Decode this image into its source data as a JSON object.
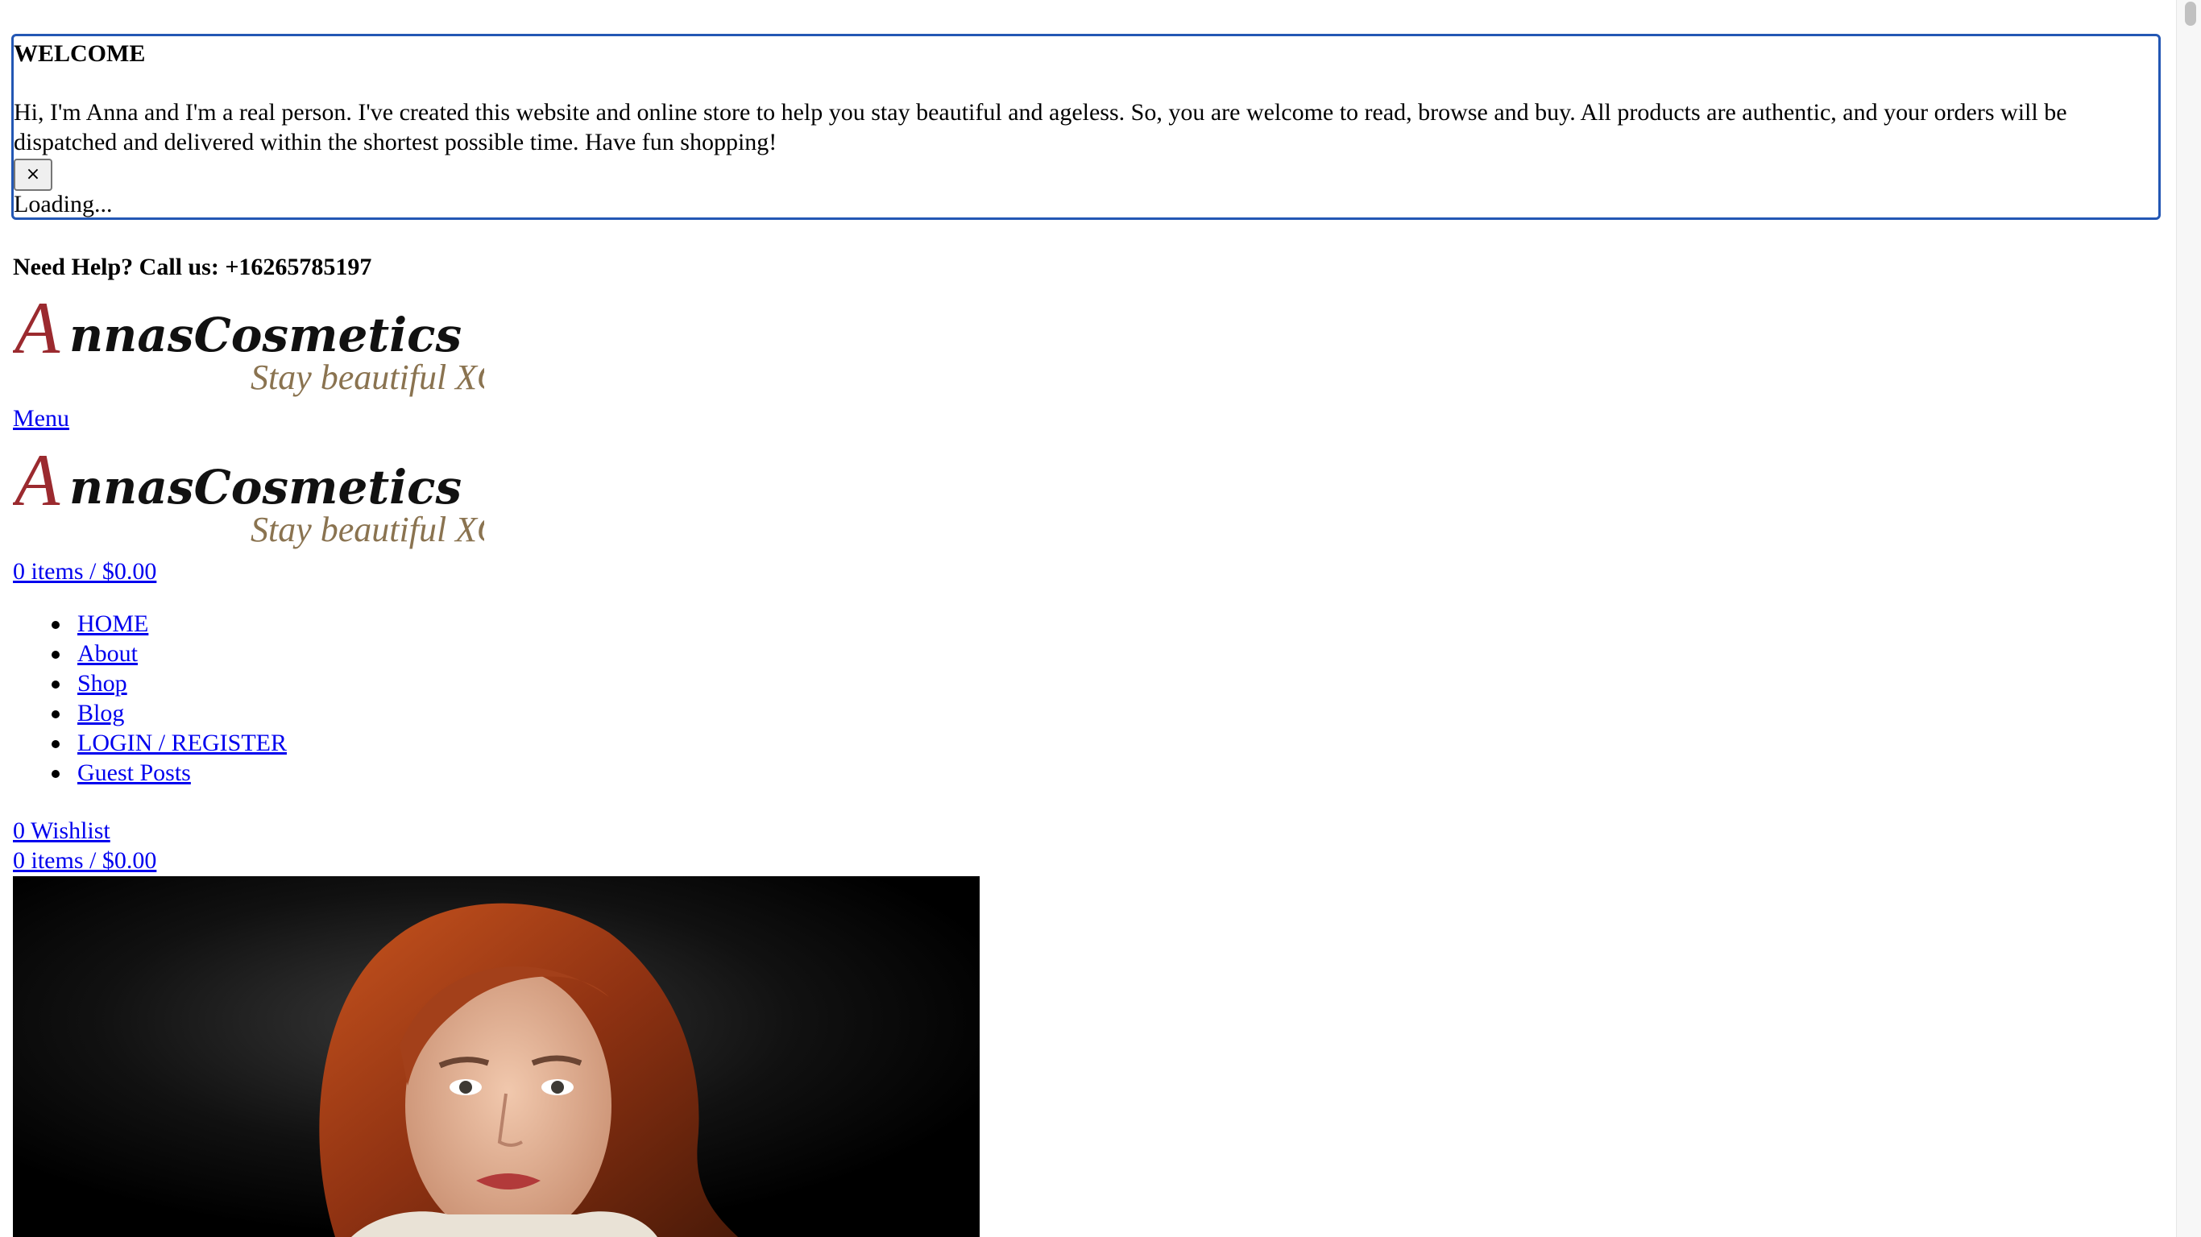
{
  "dialog": {
    "title": "WELCOME",
    "message": "Hi, I'm Anna and I'm a real person. I've created this website and online store to help you stay beautiful and ageless. So, you are welcome to read, browse and buy. All products are authentic, and your orders will be dispatched and delivered within the shortest possible time. Have fun shopping!",
    "close_label": "×",
    "loading_text": "Loading..."
  },
  "header": {
    "help_text": "Need Help? Call us: +16265785197",
    "logo": {
      "brand": "AnnasCosmetics",
      "tagline": "Stay beautiful XO"
    },
    "menu_label": "Menu",
    "cart_label": "0 items / $0.00"
  },
  "nav": {
    "items": [
      "HOME",
      "About",
      "Shop",
      "Blog",
      "LOGIN / REGISTER",
      "Guest Posts"
    ]
  },
  "footer_links": {
    "wishlist_label": "0 Wishlist",
    "cart_label": "0 items / $0.00"
  },
  "colors": {
    "dialog_border": "#2357b4",
    "link": "#0000ee",
    "logo_red": "#9b2a2f",
    "logo_tagline": "#8a7350"
  }
}
